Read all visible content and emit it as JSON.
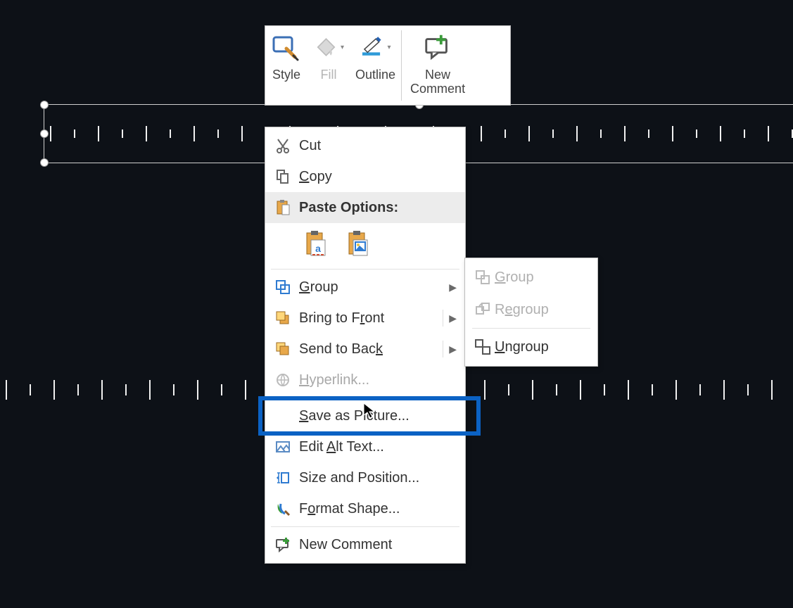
{
  "miniToolbar": {
    "style": "Style",
    "fill": "Fill",
    "outline": "Outline",
    "newComment": "New\nComment"
  },
  "contextMenu": {
    "cut": "Cut",
    "copy": "Copy",
    "pasteOptionsHeader": "Paste Options:",
    "group": "Group",
    "bringToFront": "Bring to Front",
    "sendToBack": "Send to Back",
    "hyperlink": "Hyperlink...",
    "saveAsPicture": "Save as Picture...",
    "editAltText": "Edit Alt Text...",
    "sizeAndPosition": "Size and Position...",
    "formatShape": "Format Shape...",
    "newComment": "New Comment"
  },
  "groupSubmenu": {
    "group": "Group",
    "regroup": "Regroup",
    "ungroup": "Ungroup"
  },
  "highlightedItem": "saveAsPicture",
  "colors": {
    "background": "#0d1117",
    "highlightBorder": "#0b62c4",
    "accentBlue": "#2f7bd1",
    "accentOrange": "#e08b2c"
  }
}
